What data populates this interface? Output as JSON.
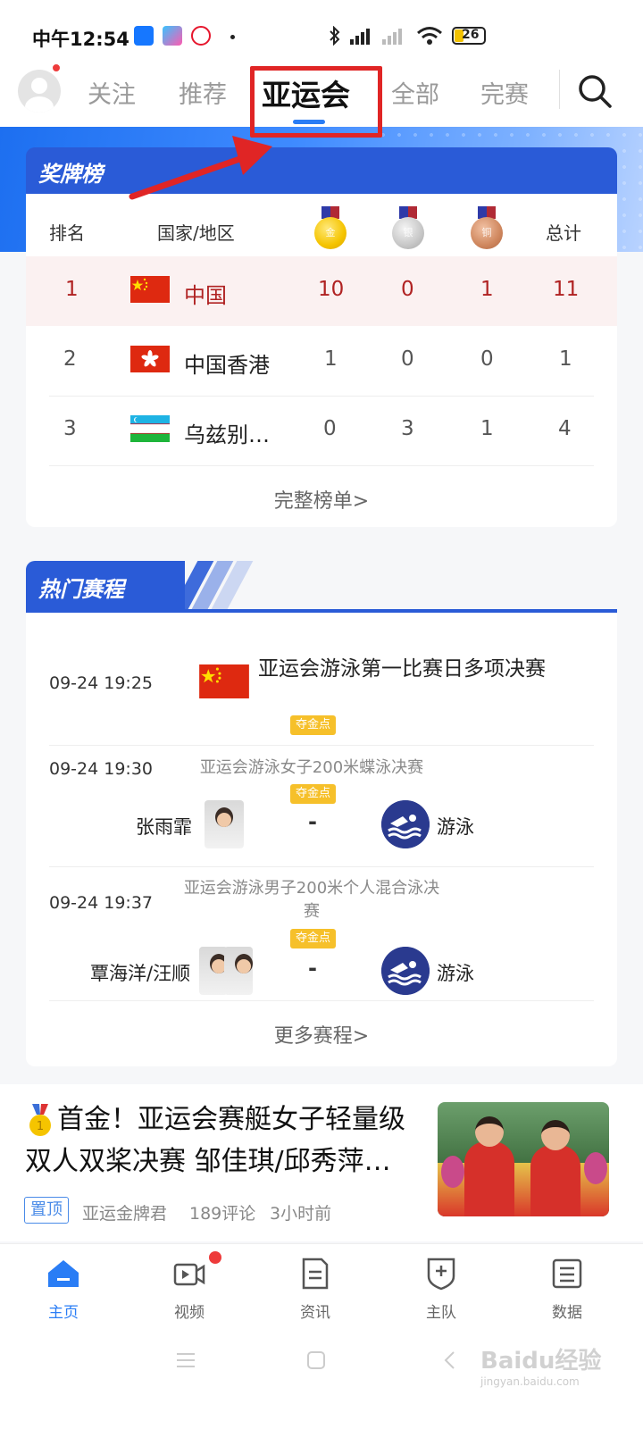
{
  "status_bar": {
    "time": "中午12:54",
    "battery": "26"
  },
  "top_nav": {
    "tabs": [
      {
        "label": "关注"
      },
      {
        "label": "推荐"
      },
      {
        "label": "亚运会"
      },
      {
        "label": "全部"
      },
      {
        "label": "完赛"
      }
    ]
  },
  "medal_table": {
    "title": "奖牌榜",
    "headers": {
      "rank": "排名",
      "country": "国家/地区",
      "gold": "金",
      "silver": "银",
      "bronze": "铜",
      "total": "总计"
    },
    "rows": [
      {
        "rank": "1",
        "country": "中国",
        "gold": "10",
        "silver": "0",
        "bronze": "1",
        "total": "11"
      },
      {
        "rank": "2",
        "country": "中国香港",
        "gold": "1",
        "silver": "0",
        "bronze": "0",
        "total": "1"
      },
      {
        "rank": "3",
        "country": "乌兹别…",
        "gold": "0",
        "silver": "3",
        "bronze": "1",
        "total": "4"
      }
    ],
    "more_label": "完整榜单>"
  },
  "schedule": {
    "title": "热门赛程",
    "events": [
      {
        "time": "09-24 19:25",
        "title": "亚运会游泳第一比赛日多项决赛",
        "badge": "夺金点"
      },
      {
        "time": "09-24 19:30",
        "title": "亚运会游泳女子200米蝶泳决赛",
        "badge": "夺金点",
        "player": "张雨霏",
        "score": "-",
        "sport": "游泳"
      },
      {
        "time": "09-24 19:37",
        "title": "亚运会游泳男子200米个人混合泳决赛",
        "badge": "夺金点",
        "player": "覃海洋/汪顺",
        "score": "-",
        "sport": "游泳"
      }
    ],
    "more_label": "更多赛程>"
  },
  "news": {
    "title": "首金！亚运会赛艇女子轻量级双人双桨决赛 邹佳琪/邱秀萍…",
    "pin": "置顶",
    "author": "亚运金牌君",
    "comments": "189评论",
    "time": "3小时前"
  },
  "bottom_nav": {
    "items": [
      {
        "label": "主页"
      },
      {
        "label": "视频"
      },
      {
        "label": "资讯"
      },
      {
        "label": "主队"
      },
      {
        "label": "数据"
      }
    ]
  },
  "watermark": {
    "text": "Baidu经验",
    "sub": "jingyan.baidu.com"
  },
  "colors": {
    "accent": "#2a7df5",
    "header_blue": "#2a5bd7",
    "highlight_red": "#e02525",
    "badge_yellow": "#f6c02a"
  }
}
